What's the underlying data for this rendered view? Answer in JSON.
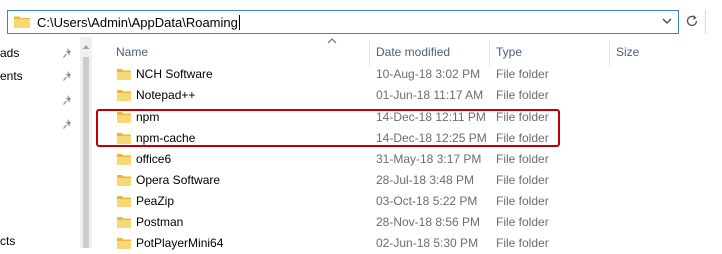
{
  "address_bar": {
    "path": "C:\\Users\\Admin\\AppData\\Roaming",
    "folder_icon": "folder-icon",
    "dropdown_icon": "chevron-down-icon",
    "refresh_icon": "refresh-icon"
  },
  "nav_pane": {
    "items": [
      {
        "label": "ads",
        "pinned": true
      },
      {
        "label": "ents",
        "pinned": true
      },
      {
        "label": "",
        "pinned": true
      },
      {
        "label": "",
        "pinned": true
      },
      {
        "label": "cts",
        "pinned": false
      }
    ]
  },
  "columns": {
    "name": "Name",
    "date_modified": "Date modified",
    "type": "Type",
    "size": "Size",
    "sorted_by": "Name"
  },
  "files": [
    {
      "name": "NCH Software",
      "date": "10-Aug-18 3:02 PM",
      "type": "File folder",
      "size": ""
    },
    {
      "name": "Notepad++",
      "date": "01-Jun-18 11:17 AM",
      "type": "File folder",
      "size": ""
    },
    {
      "name": "npm",
      "date": "14-Dec-18 12:11 PM",
      "type": "File folder",
      "size": ""
    },
    {
      "name": "npm-cache",
      "date": "14-Dec-18 12:25 PM",
      "type": "File folder",
      "size": ""
    },
    {
      "name": "office6",
      "date": "31-May-18 3:17 PM",
      "type": "File folder",
      "size": ""
    },
    {
      "name": "Opera Software",
      "date": "28-Jul-18 3:48 PM",
      "type": "File folder",
      "size": ""
    },
    {
      "name": "PeaZip",
      "date": "03-Oct-18 5:22 PM",
      "type": "File folder",
      "size": ""
    },
    {
      "name": "Postman",
      "date": "28-Nov-18 8:56 PM",
      "type": "File folder",
      "size": ""
    },
    {
      "name": "PotPlayerMini64",
      "date": "02-Jun-18 5:30 PM",
      "type": "File folder",
      "size": ""
    }
  ],
  "colors": {
    "accent_border": "#3c7fd3",
    "highlight_box": "#c00000",
    "folder_yellow": "#f8d775"
  }
}
